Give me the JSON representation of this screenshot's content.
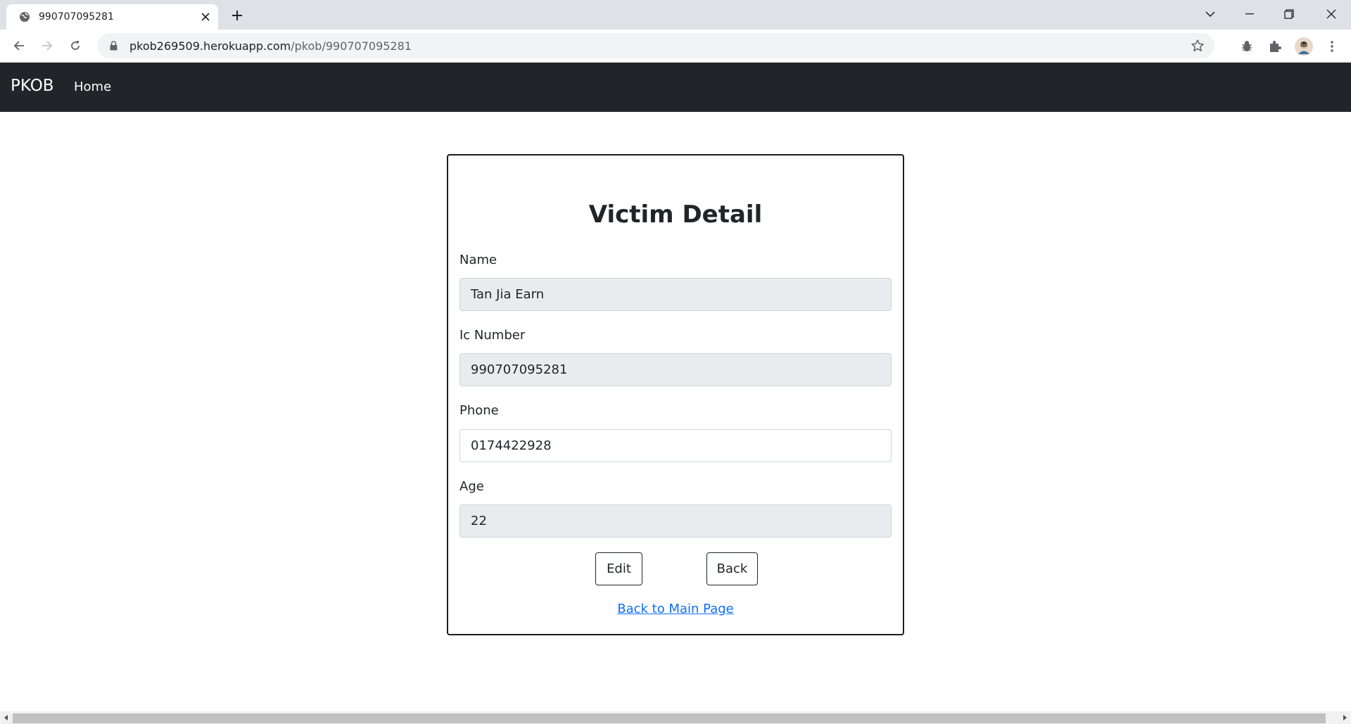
{
  "browser": {
    "tab_title": "990707095281",
    "url_host": "pkob269509.herokuapp.com",
    "url_path": "/pkob/990707095281"
  },
  "navbar": {
    "brand": "PKOB",
    "home": "Home"
  },
  "card": {
    "title": "Victim Detail",
    "fields": [
      {
        "label": "Name",
        "value": "Tan Jia Earn",
        "readonly": true
      },
      {
        "label": "Ic Number",
        "value": "990707095281",
        "readonly": true
      },
      {
        "label": "Phone",
        "value": "0174422928",
        "readonly": false
      },
      {
        "label": "Age",
        "value": "22",
        "readonly": true
      }
    ],
    "edit_label": "Edit",
    "back_label": "Back",
    "main_link": "Back to Main Page"
  }
}
